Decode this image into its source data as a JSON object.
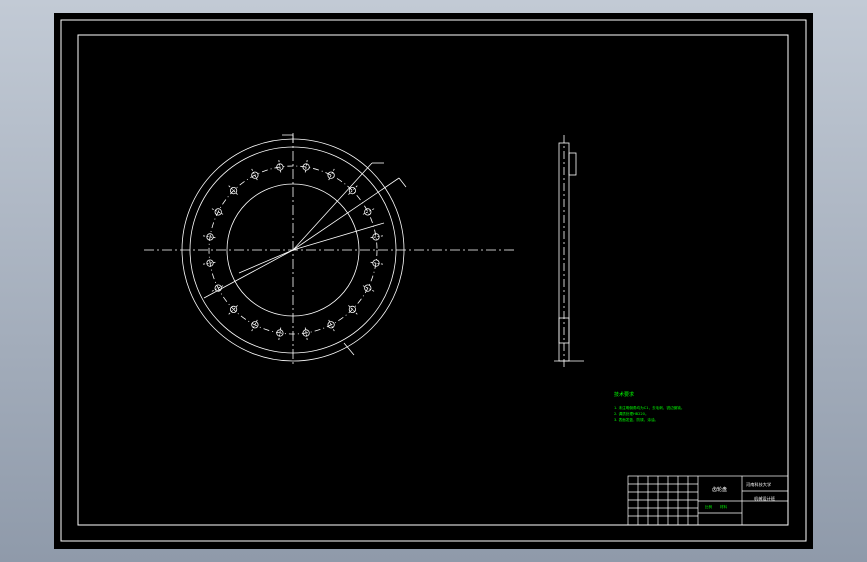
{
  "viewport": {
    "background_colors": [
      "#c2cad5",
      "#8f9aaa"
    ],
    "sheet_color": "#000000",
    "line_color": "#ffffff",
    "note_color": "#00ff00"
  },
  "drawing": {
    "notes_title": "技术要求",
    "notes": [
      "1. 未注明倒角均为C1，去毛刺，锐边倒钝。",
      "2. 调质处理HB220。",
      "3. 表面发蓝，防锈，涂油。"
    ],
    "title_block": {
      "part_name": "齿轮盘",
      "school": "河南科技大学",
      "class_info": "机械设计班",
      "scale_label": "比例",
      "material_label": "材料"
    }
  }
}
